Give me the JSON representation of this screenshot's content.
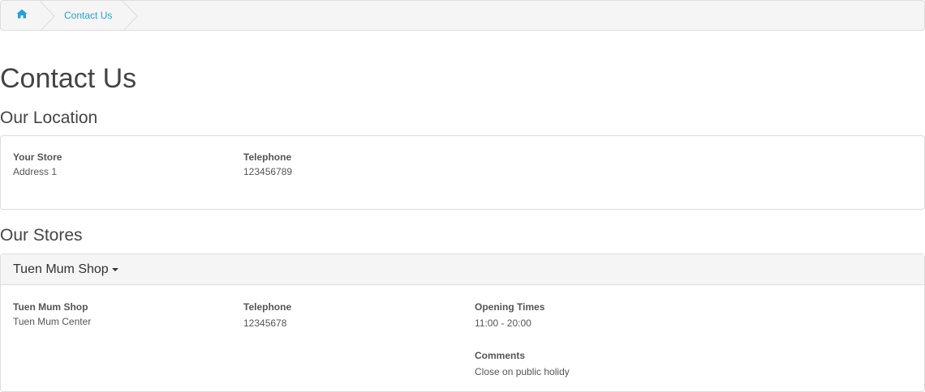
{
  "breadcrumb": {
    "home_icon": "home-icon",
    "items": [
      "Contact Us"
    ]
  },
  "page_title": "Contact Us",
  "location": {
    "section_title": "Our Location",
    "store_name": "Your Store",
    "address": "Address 1",
    "telephone_label": "Telephone",
    "telephone": "123456789"
  },
  "stores": {
    "section_title": "Our Stores",
    "panel_heading": "Tuen Mum Shop",
    "store_name": "Tuen Mum Shop",
    "address": "Tuen Mum Center",
    "telephone_label": "Telephone",
    "telephone": "12345678",
    "opening_label": "Opening Times",
    "opening": "11:00 - 20:00",
    "comments_label": "Comments",
    "comments": "Close on public holidy"
  },
  "colors": {
    "link": "#23a1d1",
    "border": "#dddddd",
    "panel_bg": "#f5f5f5",
    "text": "#444444"
  }
}
